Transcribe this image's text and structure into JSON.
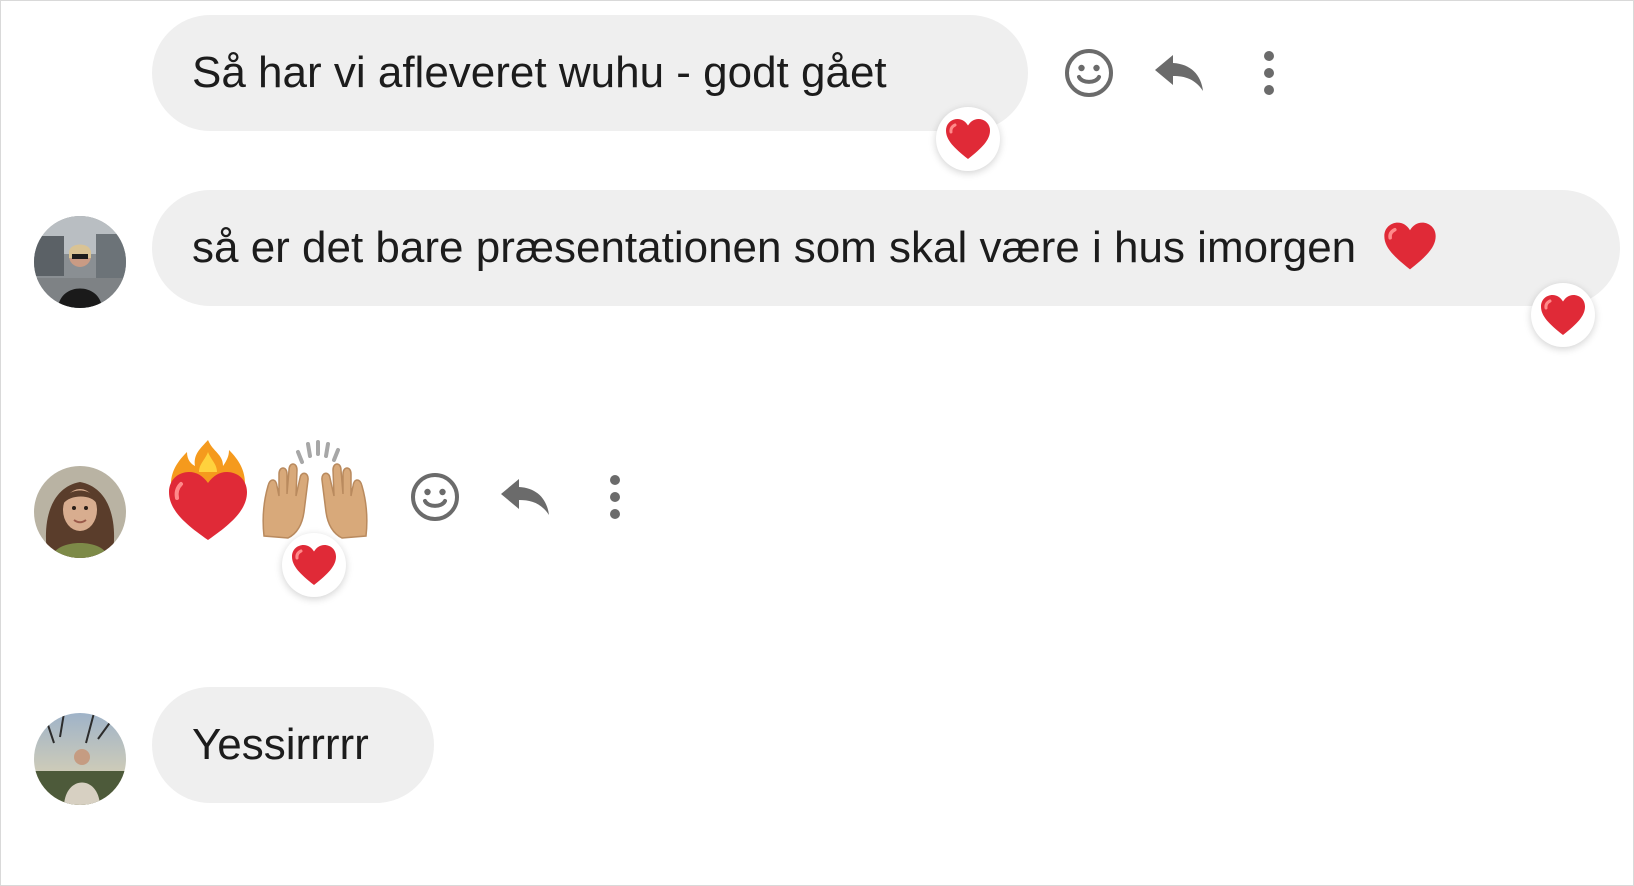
{
  "messages": [
    {
      "id": "m1",
      "text": "Så har vi afleveret wuhu - godt gået",
      "has_avatar": false,
      "reaction": "red-heart",
      "actions": [
        "smiley-icon",
        "reply-icon",
        "more-icon"
      ]
    },
    {
      "id": "m2",
      "text": "så er det bare præsentationen som skal være i hus imorgen",
      "inline_emoji": "red-heart",
      "has_avatar": true,
      "reaction": "red-heart"
    },
    {
      "id": "m3",
      "emojis": [
        "heart-on-fire",
        "raising-hands"
      ],
      "has_avatar": true,
      "reaction": "red-heart",
      "actions": [
        "smiley-icon",
        "reply-icon",
        "more-icon"
      ]
    },
    {
      "id": "m4",
      "text": "Yessirrrrr",
      "has_avatar": true
    }
  ],
  "colors": {
    "bubble": "#efefef",
    "icon_gray": "#6b6b6b",
    "heart_red": "#e02a37"
  }
}
